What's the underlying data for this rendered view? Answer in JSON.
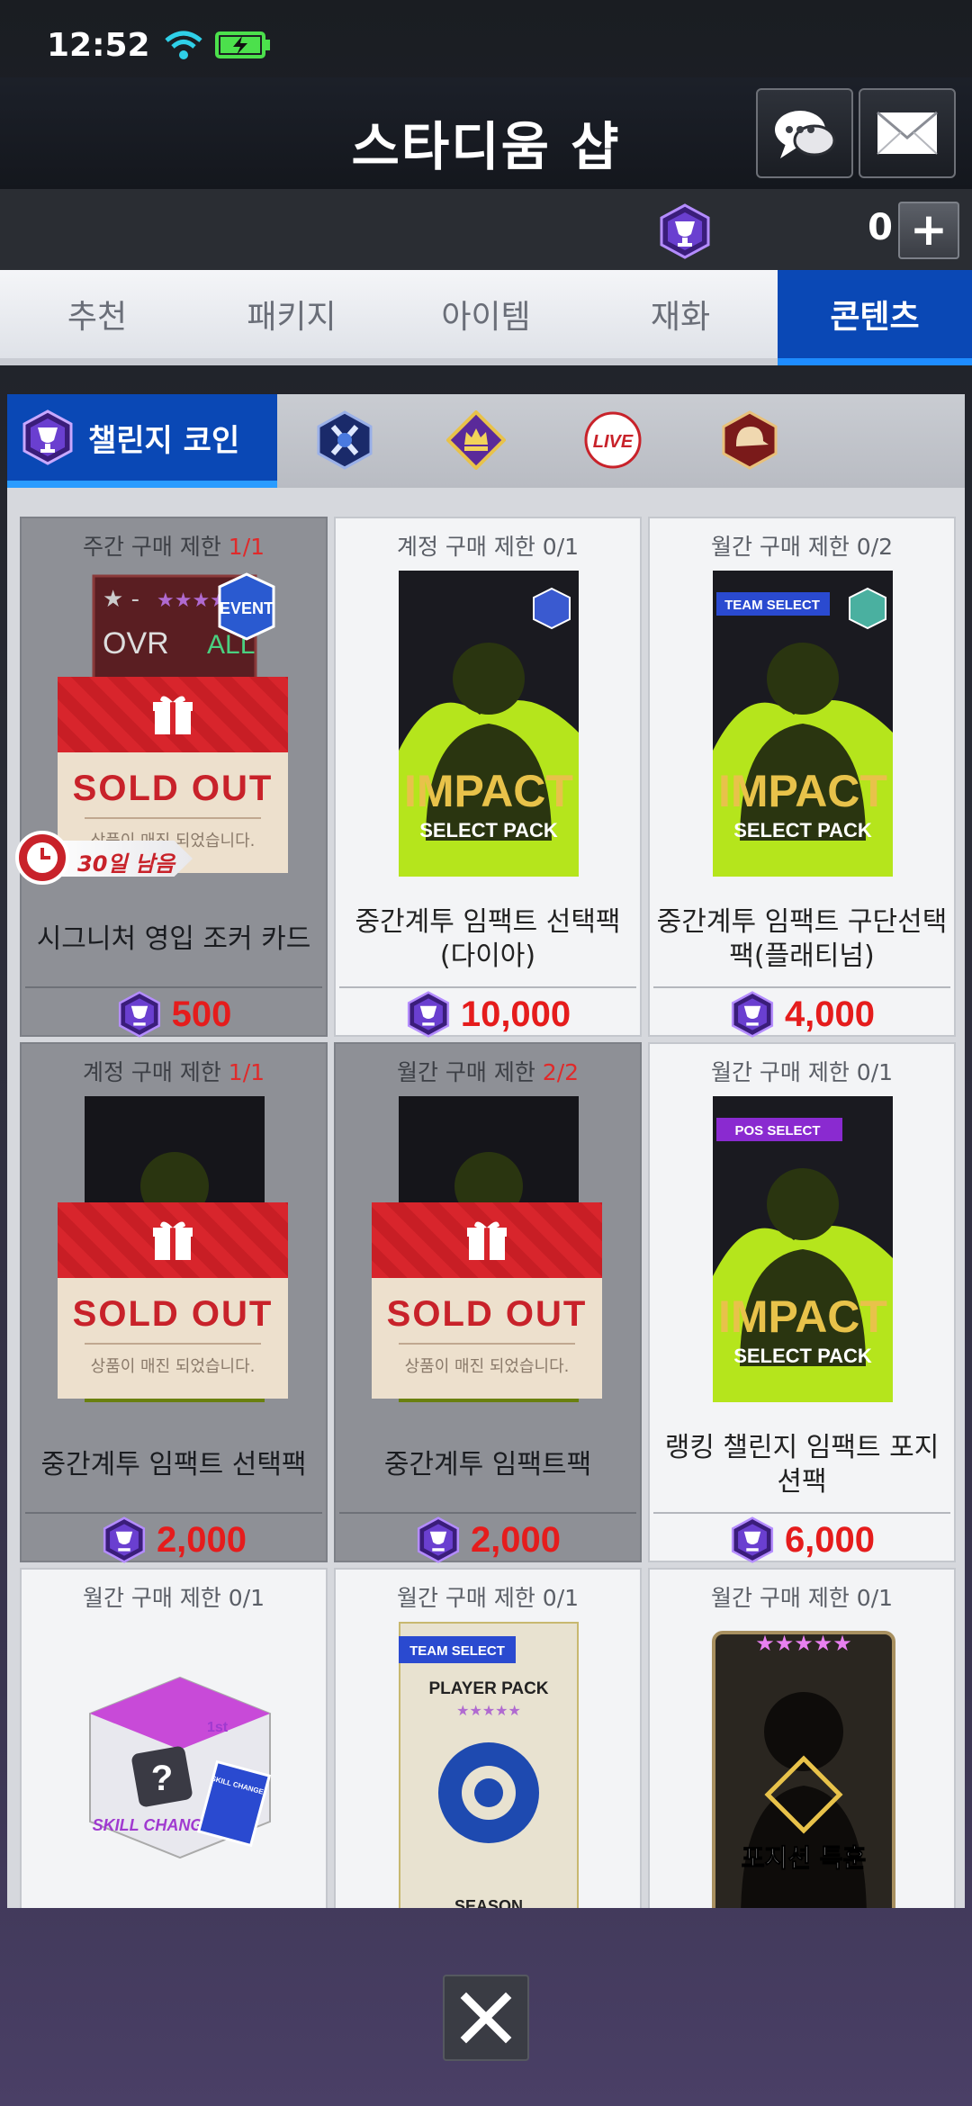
{
  "status_bar": {
    "time": "12:52"
  },
  "header": {
    "title": "스타디움 샵"
  },
  "currency": {
    "amount": "0",
    "plus": "+"
  },
  "tabs": [
    {
      "label": "추천"
    },
    {
      "label": "패키지"
    },
    {
      "label": "아이템"
    },
    {
      "label": "재화"
    },
    {
      "label": "콘텐츠",
      "active": true
    }
  ],
  "subtabs": {
    "active_label": "챌린지 코인",
    "others": [
      "shield-emblem-icon",
      "crown-emblem-icon",
      "live-badge-icon",
      "helmet-emblem-icon"
    ]
  },
  "products": [
    {
      "limit_prefix": "주간 구매 제한 ",
      "limit_value": "1/1",
      "limit_red": true,
      "name": "시그니처 영입 조커 카드",
      "price": "500",
      "sold_out": true,
      "card_text": {
        "ovr": "OVR",
        "all": "ALL",
        "event": "EVENT"
      },
      "timer": "30일 남음"
    },
    {
      "limit_prefix": "계정 구매 제한 ",
      "limit_value": "0/1",
      "limit_red": false,
      "name": "중간계투 임팩트 선택팩(다이아)",
      "price": "10,000",
      "sold_out": false,
      "pack": {
        "title": "IMPACT",
        "subtitle": "SELECT PACK",
        "badge": "DIAMOND"
      }
    },
    {
      "limit_prefix": "월간 구매 제한 ",
      "limit_value": "0/2",
      "limit_red": false,
      "name": "중간계투 임팩트 구단선택팩(플래티넘)",
      "price": "4,000",
      "sold_out": false,
      "pack": {
        "title": "IMPACT",
        "subtitle": "SELECT PACK",
        "badge": "PLATINUM",
        "tag": "TEAM SELECT"
      }
    },
    {
      "limit_prefix": "계정 구매 제한 ",
      "limit_value": "1/1",
      "limit_red": true,
      "name": "중간계투 임팩트 선택팩",
      "price": "2,000",
      "sold_out": true
    },
    {
      "limit_prefix": "월간 구매 제한 ",
      "limit_value": "2/2",
      "limit_red": true,
      "name": "중간계투 임팩트팩",
      "price": "2,000",
      "sold_out": true
    },
    {
      "limit_prefix": "월간 구매 제한 ",
      "limit_value": "0/1",
      "limit_red": false,
      "name": "랭킹 챌린지 임팩트 포지션팩",
      "price": "6,000",
      "sold_out": false,
      "pack": {
        "title": "IMPACT",
        "subtitle": "SELECT PACK",
        "tag": "POS SELECT"
      }
    },
    {
      "limit_prefix": "월간 구매 제한 ",
      "limit_value": "0/1",
      "limit_red": false,
      "name": "",
      "price": "",
      "sold_out": false,
      "box": {
        "label": "SKILL CHANGE",
        "brand": "1st",
        "card": "SKILL CHANGE"
      }
    },
    {
      "limit_prefix": "월간 구매 제한 ",
      "limit_value": "0/1",
      "limit_red": false,
      "name": "",
      "price": "",
      "sold_out": false,
      "pack": {
        "tag": "TEAM SELECT",
        "title": "PLAYER PACK",
        "subtitle": "SEASON"
      }
    },
    {
      "limit_prefix": "월간 구매 제한 ",
      "limit_value": "0/1",
      "limit_red": false,
      "name": "",
      "price": "",
      "sold_out": false,
      "card": {
        "label": "포지션 특훈"
      }
    }
  ],
  "sold_out": {
    "title": "SOLD OUT",
    "subtitle": "상품이 매진 되었습니다."
  },
  "colors": {
    "accent_blue": "#0a48b5",
    "price_red": "#e51c1c",
    "limit_red": "#e02a2a",
    "neon_green": "#b5e51c"
  }
}
